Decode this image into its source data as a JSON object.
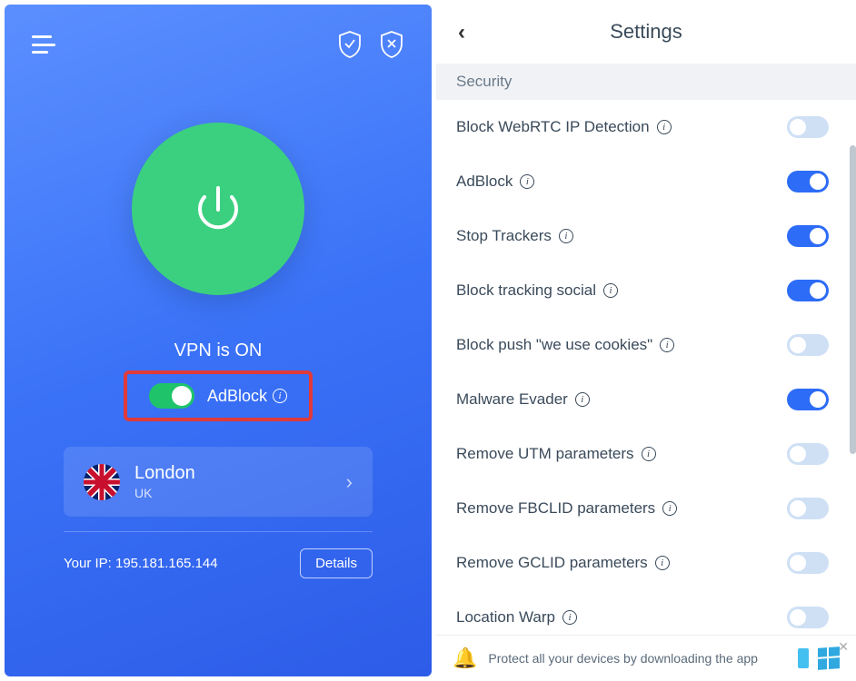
{
  "left": {
    "status": "VPN is ON",
    "adblock_label": "AdBlock",
    "location": {
      "city": "London",
      "country": "UK"
    },
    "ip_label": "Your IP: 195.181.165.144",
    "details_btn": "Details"
  },
  "settings": {
    "title": "Settings",
    "section": "Security",
    "items": [
      {
        "label": "Block WebRTC IP Detection",
        "on": false
      },
      {
        "label": "AdBlock",
        "on": true
      },
      {
        "label": "Stop Trackers",
        "on": true
      },
      {
        "label": "Block tracking social",
        "on": true
      },
      {
        "label": "Block push \"we use cookies\"",
        "on": false
      },
      {
        "label": "Malware Evader",
        "on": true
      },
      {
        "label": "Remove UTM parameters",
        "on": false
      },
      {
        "label": "Remove FBCLID parameters",
        "on": false
      },
      {
        "label": "Remove GCLID parameters",
        "on": false
      },
      {
        "label": "Location Warp",
        "on": false
      }
    ],
    "promo": "Protect all your devices by downloading the app"
  }
}
